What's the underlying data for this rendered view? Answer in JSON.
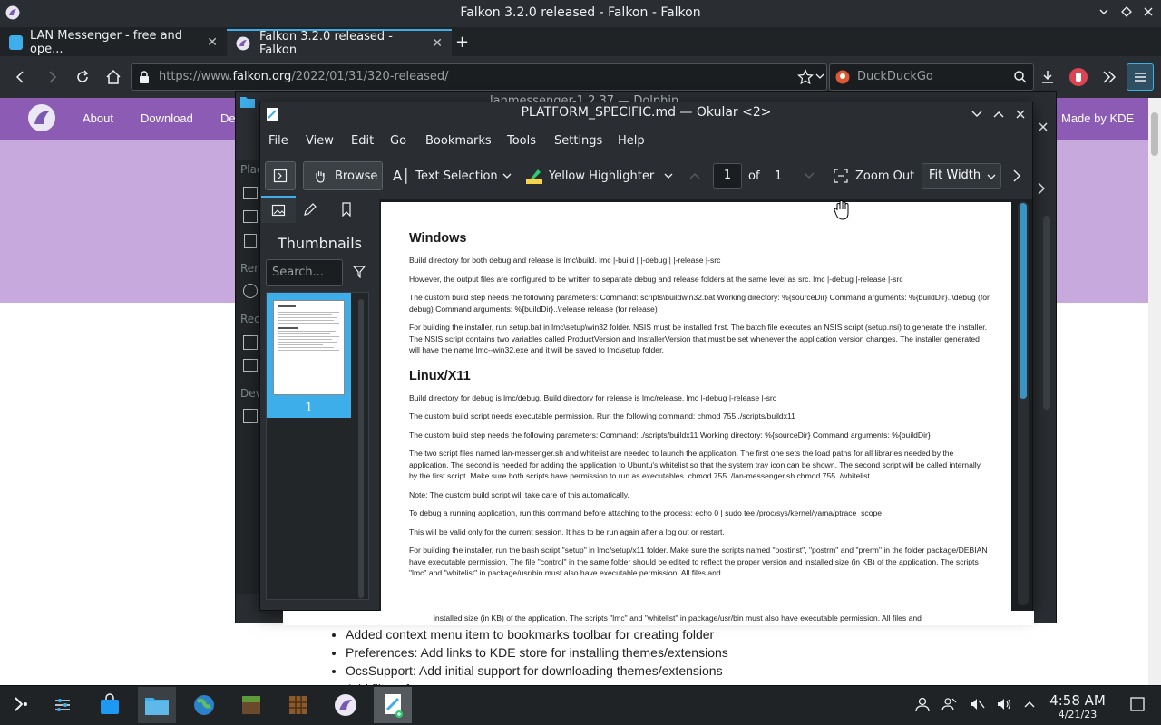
{
  "browser": {
    "window_title": "Falkon 3.2.0 released - Falkon - Falkon",
    "tabs": [
      {
        "label": "LAN Messenger - free and ope...",
        "active": false
      },
      {
        "label": "Falkon 3.2.0 released - Falkon",
        "active": true
      }
    ],
    "url_prefix": "https://www.",
    "url_host": "falkon.org",
    "url_path": "/2022/01/31/320-released/",
    "search_placeholder": "DuckDuckGo"
  },
  "website": {
    "nav": [
      "About",
      "Download",
      "De"
    ],
    "made_by": "Made by KDE",
    "changelog": [
      "Added context menu item to bookmarks toolbar for creating folder",
      "Preferences: Add links to KDE store for installing themes/extensions",
      "OcsSupport: Add initial support for downloading themes/extensions",
      "Add filters for ..."
    ]
  },
  "dolphin": {
    "title": "lanmessenger-1.2.37 — Dolphin",
    "side_labels": [
      "Plac",
      "Rem",
      "Rec",
      "Devi"
    ]
  },
  "okular": {
    "title": "PLATFORM_SPECIFIC.md — Okular <2>",
    "menu": [
      "File",
      "View",
      "Edit",
      "Go",
      "Bookmarks",
      "Tools",
      "Settings",
      "Help"
    ],
    "toolbar": {
      "browse": "Browse",
      "text_selection": "Text Selection",
      "highlighter": "Yellow Highlighter",
      "page_current": "1",
      "page_of": "of",
      "page_total": "1",
      "zoom_out": "Zoom Out",
      "zoom_mode": "Fit Width"
    },
    "sidebar": {
      "heading": "Thumbnails",
      "search_placeholder": "Search...",
      "thumb_number": "1"
    },
    "document": {
      "windows_heading": "Windows",
      "windows_paragraphs": [
        "Build directory for both debug and release is lmc\\build. lmc |-build | |-debug | |-release |-src",
        "However, the output files are configured to be written to separate debug and release folders at the same level as src. lmc |-debug |-release |-src",
        "The custom build step needs the following parameters: Command: scripts\\buildwin32.bat Working directory: %{sourceDir} Command arguments: %{buildDir}..\\debug (for debug) Command arguments: %{buildDir}..\\release release (for release)",
        "For building the installer, run setup.bat in lmc\\setup\\win32 folder. NSIS must be installed first. The batch file executes an NSIS script (setup.nsi) to generate the installer. The NSIS script contains two variables called ProductVersion and InstallerVersion that must be set whenever the application version changes. The installer generated will have the name lmc--win32.exe and it will be saved to lmc\\setup folder."
      ],
      "linux_heading": "Linux/X11",
      "linux_paragraphs": [
        "Build directory for debug is lmc/debug. Build directory for release is lmc/release. lmc |-debug |-release |-src",
        "The custom build script needs executable permission. Run the following command: chmod 755 ./scripts/buildx11",
        "The custom build step needs the following parameters: Command: ./scripts/buildx11 Working directory: %{sourceDir} Command arguments: %{buildDir}",
        "The two script files named lan-messenger.sh and whitelist are needed to launch the application. The first one sets the load paths for all libraries needed by the application. The second is needed for adding the application to Ubuntu's whitelist so that the system tray icon can be shown. The second script will be called internally by the first script. Make sure both scripts have permission to run as executables. chmod 755 ./lan-messenger.sh chmod 755 ./whitelist",
        "Note: The custom build script will take care of this automatically.",
        "To debug a running application, run this command before attaching to the process: echo 0 | sudo tee /proc/sys/kernel/yama/ptrace_scope",
        "This will be valid only for the current session. It has to be run again after a log out or restart.",
        "For building the installer, run the bash script \"setup\" in lmc/setup/x11 folder. Make sure the scripts named \"postinst\", \"postrm\" and \"prerm\" in the folder package/DEBIAN have executable permission. The file \"control\" in the same folder should be edited to reflect the proper version and installed size (in KB) of the application. The scripts \"lmc\" and \"whitelist\" in package/usr/bin must also have executable permission. All files and"
      ],
      "overflow_line": "installed size (in KB) of the application. The scripts \"lmc\" and \"whitelist\" in package/usr/bin must also have executable permission. All files and"
    }
  },
  "taskbar": {
    "time": "4:58 AM",
    "date": "4/21/23"
  },
  "colors": {
    "accent": "#3daee9",
    "site_header": "#8c5cb4",
    "site_hero": "#c7a9de",
    "panel_bg": "#2a2e32"
  }
}
